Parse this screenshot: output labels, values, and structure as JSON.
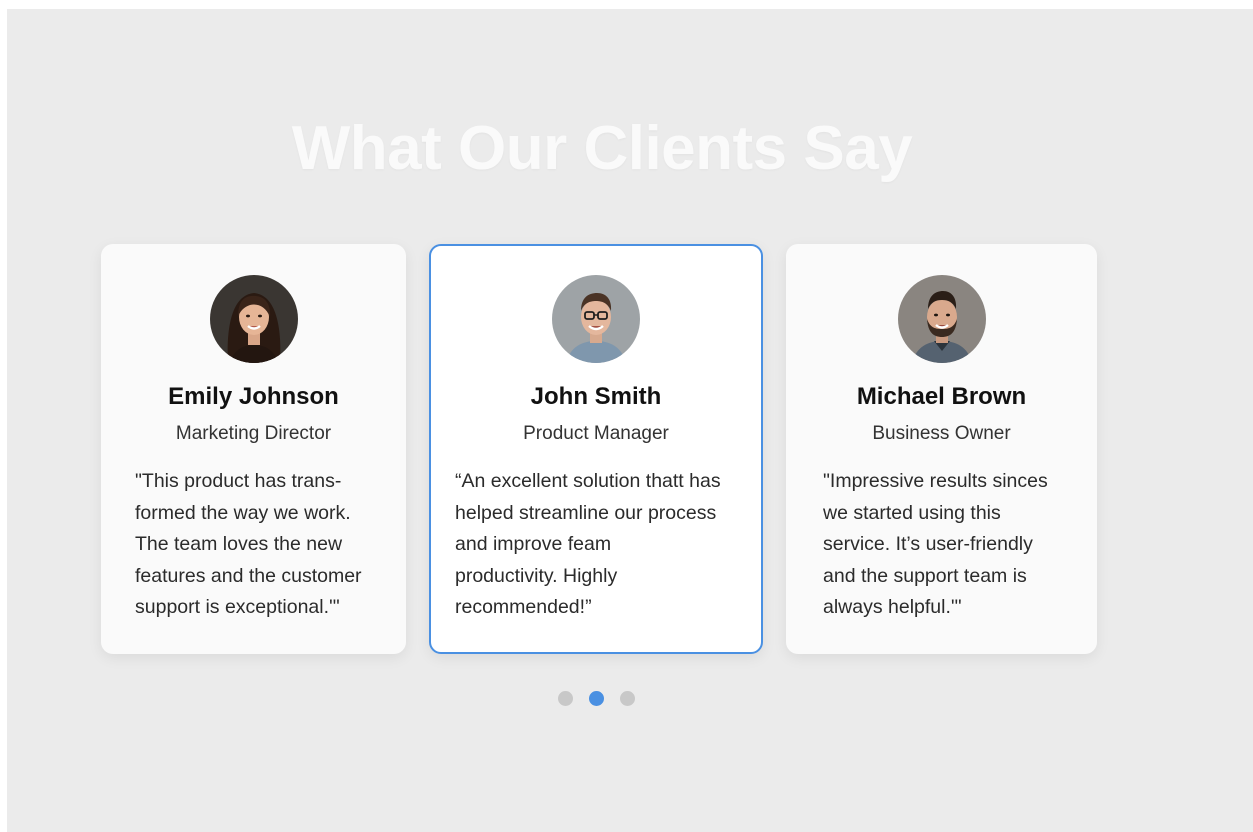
{
  "section": {
    "title": "What Our Clients Say"
  },
  "testimonials": [
    {
      "name": "Emily Johnson",
      "role": "Marketing Director",
      "quote": "\"This product has trans-\nformed the way we work.\nThe team loves the new\nfeatures and the customer\nsupport is exceptional.'\"",
      "avatar_icon": "woman-portrait-icon",
      "active": false
    },
    {
      "name": "John Smith",
      "role": "Product Manager",
      "quote": "“An excellent solution thatt has\n   helped streamline our process\n   and improve feam\n   productivity. Highly\n   recommended!”",
      "avatar_icon": "man-glasses-portrait-icon",
      "active": true
    },
    {
      "name": "Michael Brown",
      "role": "Business Owner",
      "quote": "\"Impressive results sinces\nwe started using this\nservice. It’s user-friendly\nand the support team is\nalways helpful.'\"",
      "avatar_icon": "man-beard-portrait-icon",
      "active": false
    }
  ],
  "pagination": {
    "count": 3,
    "active_index": 1
  },
  "colors": {
    "background": "#ebebeb",
    "card": "#fafafa",
    "accent": "#4a90e2",
    "dot_inactive": "#c8c8c8",
    "title": "#fafafa"
  }
}
